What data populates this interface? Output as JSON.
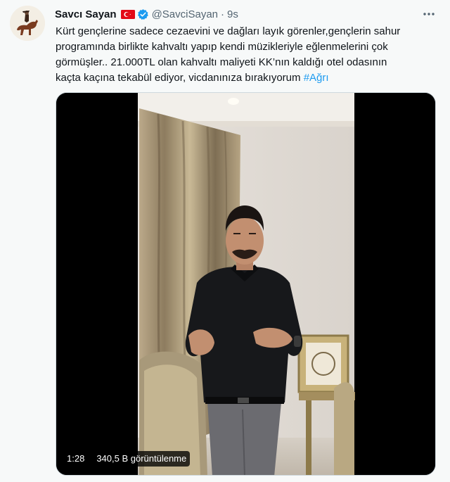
{
  "tweet": {
    "author_name": "Savcı Sayan",
    "handle": "@SavciSayan",
    "separator": "·",
    "time": "9s",
    "text_lines": [
      "Kürt gençlerine sadece cezaevini ve dağları layık görenler,gençlerin sahur",
      "programında birlikte kahvaltı yapıp kendi müzikleriyle eğlenmelerini çok",
      "görmüşler.. 21.000TL olan kahvaltı maliyeti  KK’nın kaldığı otel odasının",
      "kaçta kaçına tekabül ediyor, vicdanınıza bırakıyorum "
    ],
    "hashtag": "#Ağrı",
    "icons": {
      "flag": "turkey-flag-icon",
      "verified": "verified-badge-icon",
      "more": "more-options-icon"
    },
    "colors": {
      "accent": "#1d9bf0",
      "flag_red": "#e30a17",
      "secondary_text": "#536471"
    }
  },
  "video": {
    "duration": "1:28",
    "views": "340,5 B görüntülenme"
  }
}
